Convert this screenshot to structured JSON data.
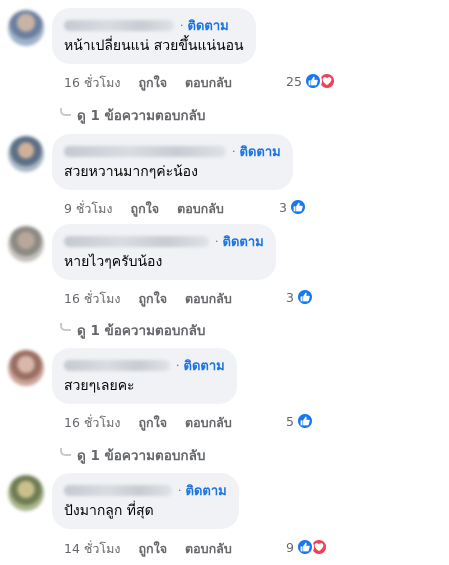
{
  "comments": [
    {
      "follow": "ติดตาม",
      "text": "หน้าเปลี่ยนแน่ สวยขึ้นแน่นอน",
      "time": "16 ชั่วโมง",
      "like": "ถูกใจ",
      "reply": "ตอบกลับ",
      "reactions": "25",
      "reaction_icons": [
        "like-icon",
        "love-icon"
      ],
      "replies": "ดู 1 ข้อความตอบกลับ"
    },
    {
      "follow": "ติดตาม",
      "text": "สวยหวานมากๆค่ะน้อง",
      "time": "9 ชั่วโมง",
      "like": "ถูกใจ",
      "reply": "ตอบกลับ",
      "reactions": "3",
      "reaction_icons": [
        "like-icon"
      ]
    },
    {
      "follow": "ติดตาม",
      "text": "หายไวๆครับน้อง",
      "time": "16 ชั่วโมง",
      "like": "ถูกใจ",
      "reply": "ตอบกลับ",
      "reactions": "3",
      "reaction_icons": [
        "like-icon"
      ],
      "replies": "ดู 1 ข้อความตอบกลับ"
    },
    {
      "follow": "ติดตาม",
      "text": "สวยๆเลยคะ",
      "time": "16 ชั่วโมง",
      "like": "ถูกใจ",
      "reply": "ตอบกลับ",
      "reactions": "5",
      "reaction_icons": [
        "like-icon"
      ],
      "replies": "ดู 1 ข้อความตอบกลับ"
    },
    {
      "follow": "ติดตาม",
      "text": "ปังมากลูก ที่สุด",
      "time": "14 ชั่วโมง",
      "like": "ถูกใจ",
      "reply": "ตอบกลับ",
      "reactions": "9",
      "reaction_icons": [
        "like-icon",
        "love-icon"
      ]
    }
  ],
  "colors": {
    "accent": "#1b74e4",
    "like": "#1877f2",
    "love": "#f33e58",
    "bubble": "#f0f2f5",
    "muted": "#65676b"
  }
}
